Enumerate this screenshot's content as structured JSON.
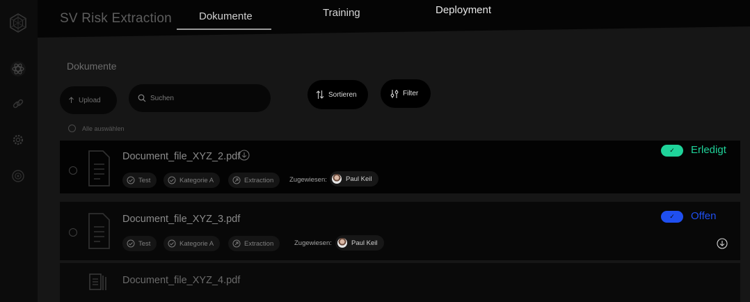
{
  "app": {
    "title": "SV Risk Extraction"
  },
  "nav": {
    "tabs": [
      {
        "label": "Dokumente",
        "active": true
      },
      {
        "label": "Training",
        "active": false
      },
      {
        "label": "Deployment",
        "active": false
      }
    ]
  },
  "sidebar": {
    "items": [
      {
        "icon": "logo-icon"
      },
      {
        "icon": "atom-icon"
      },
      {
        "icon": "link-icon"
      },
      {
        "icon": "gear-icon"
      },
      {
        "icon": "settings-icon"
      }
    ]
  },
  "page": {
    "title": "Dokumente"
  },
  "toolbar": {
    "upload_label": "Upload",
    "search_placeholder": "Suchen",
    "sort_label": "Sortieren",
    "filter_label": "Filter",
    "select_all_label": "Alle auswählen"
  },
  "colors": {
    "done": "#1fd39a",
    "open": "#1f4ff0"
  },
  "documents": [
    {
      "name": "Document_file_XYZ_2.pdf",
      "tags": [
        "Test",
        "Kategorie A",
        "Extraction"
      ],
      "assigned_label": "Zugewiesen:",
      "assignee": "Paul Keil",
      "status": "Erledigt",
      "status_check": "✓"
    },
    {
      "name": "Document_file_XYZ_3.pdf",
      "tags": [
        "Test",
        "Kategorie A",
        "Extraction"
      ],
      "assigned_label": "Zugewiesen:",
      "assignee": "Paul Keil",
      "status": "Offen",
      "status_check": "✓"
    },
    {
      "name": "Document_file_XYZ_4.pdf"
    }
  ]
}
